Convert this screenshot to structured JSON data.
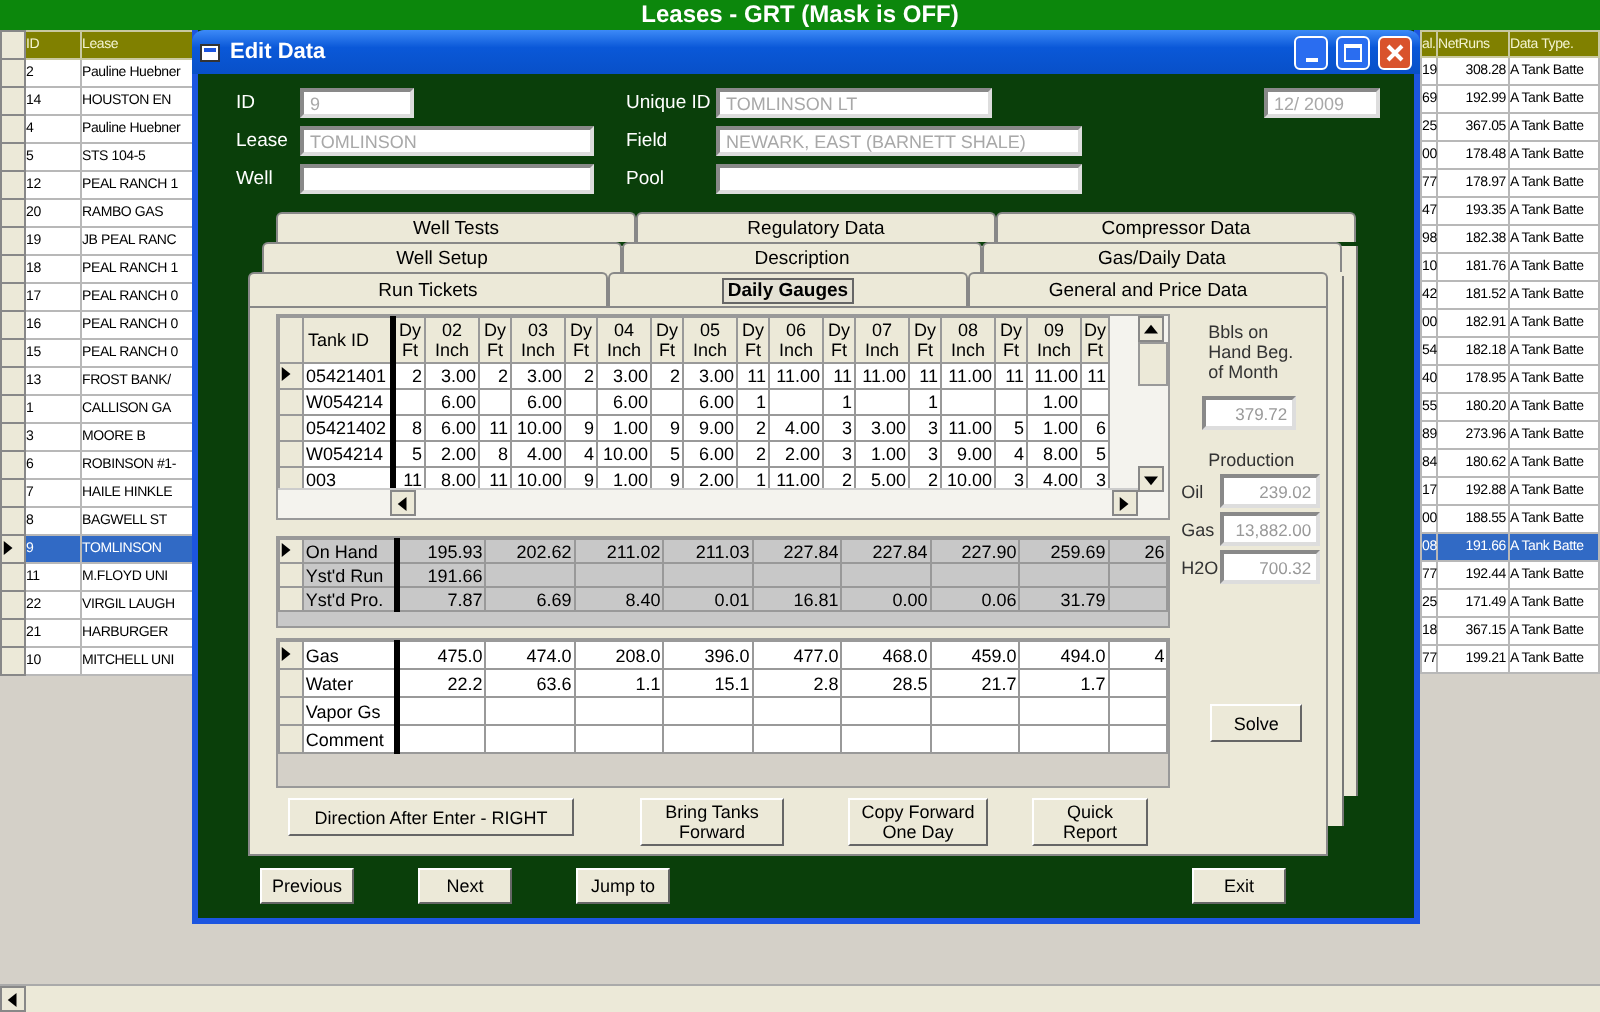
{
  "app_title": "Leases - GRT (Mask is OFF)",
  "leases": {
    "left_columns": [
      "ID",
      "Lease"
    ],
    "right_columns": [
      "al.",
      "NetRuns",
      "Data Type."
    ],
    "rows": [
      {
        "id": "2",
        "lease": "Pauline Huebner",
        "col_3": "19",
        "net_runs": "308.28",
        "data_type": "A Tank Batte",
        "selected": false
      },
      {
        "id": "14",
        "lease": "HOUSTON EN",
        "col_3": "69",
        "net_runs": "192.99",
        "data_type": "A Tank Batte",
        "selected": false
      },
      {
        "id": "4",
        "lease": "Pauline Huebner",
        "col_3": "25",
        "net_runs": "367.05",
        "data_type": "A Tank Batte",
        "selected": false
      },
      {
        "id": "5",
        "lease": "STS 104-5",
        "col_3": "00",
        "net_runs": "178.48",
        "data_type": "A Tank Batte",
        "selected": false
      },
      {
        "id": "12",
        "lease": "PEAL RANCH 1",
        "col_3": "77",
        "net_runs": "178.97",
        "data_type": "A Tank Batte",
        "selected": false
      },
      {
        "id": "20",
        "lease": "RAMBO GAS",
        "col_3": "47",
        "net_runs": "193.35",
        "data_type": "A Tank Batte",
        "selected": false
      },
      {
        "id": "19",
        "lease": "JB PEAL RANC",
        "col_3": "98",
        "net_runs": "182.38",
        "data_type": "A Tank Batte",
        "selected": false
      },
      {
        "id": "18",
        "lease": "PEAL RANCH 1",
        "col_3": "10",
        "net_runs": "181.76",
        "data_type": "A Tank Batte",
        "selected": false
      },
      {
        "id": "17",
        "lease": "PEAL RANCH 0",
        "col_3": "42",
        "net_runs": "181.52",
        "data_type": "A Tank Batte",
        "selected": false
      },
      {
        "id": "16",
        "lease": "PEAL RANCH 0",
        "col_3": "00",
        "net_runs": "182.91",
        "data_type": "A Tank Batte",
        "selected": false
      },
      {
        "id": "15",
        "lease": "PEAL RANCH 0",
        "col_3": "54",
        "net_runs": "182.18",
        "data_type": "A Tank Batte",
        "selected": false
      },
      {
        "id": "13",
        "lease": "FROST BANK/",
        "col_3": "40",
        "net_runs": "178.95",
        "data_type": "A Tank Batte",
        "selected": false
      },
      {
        "id": "1",
        "lease": "CALLISON GA",
        "col_3": "55",
        "net_runs": "180.20",
        "data_type": "A Tank Batte",
        "selected": false
      },
      {
        "id": "3",
        "lease": "MOORE B",
        "col_3": "89",
        "net_runs": "273.96",
        "data_type": "A Tank Batte",
        "selected": false
      },
      {
        "id": "6",
        "lease": "ROBINSON #1-",
        "col_3": "84",
        "net_runs": "180.62",
        "data_type": "A Tank Batte",
        "selected": false
      },
      {
        "id": "7",
        "lease": "HAILE HINKLE",
        "col_3": "17",
        "net_runs": "192.88",
        "data_type": "A Tank Batte",
        "selected": false
      },
      {
        "id": "8",
        "lease": "BAGWELL ST",
        "col_3": "00",
        "net_runs": "188.55",
        "data_type": "A Tank Batte",
        "selected": false
      },
      {
        "id": "9",
        "lease": "TOMLINSON",
        "col_3": "08",
        "net_runs": "191.66",
        "data_type": "A Tank Batte",
        "selected": true
      },
      {
        "id": "11",
        "lease": "M.FLOYD UNI",
        "col_3": "77",
        "net_runs": "192.44",
        "data_type": "A Tank Batte",
        "selected": false
      },
      {
        "id": "22",
        "lease": "VIRGIL LAUGH",
        "col_3": "25",
        "net_runs": "171.49",
        "data_type": "A Tank Batte",
        "selected": false
      },
      {
        "id": "21",
        "lease": "HARBURGER",
        "col_3": "18",
        "net_runs": "367.15",
        "data_type": "A Tank Batte",
        "selected": false
      },
      {
        "id": "10",
        "lease": "MITCHELL UNI",
        "col_3": "77",
        "net_runs": "199.21",
        "data_type": "A Tank Batte",
        "selected": false
      }
    ]
  },
  "dialog": {
    "title": "Edit Data",
    "fields": {
      "id": {
        "label": "ID",
        "value": "9"
      },
      "unique_id": {
        "label": "Unique ID",
        "value": "TOMLINSON LT"
      },
      "date": {
        "value": "12/ 2009"
      },
      "lease": {
        "label": "Lease",
        "value": "TOMLINSON"
      },
      "field": {
        "label": "Field",
        "value": "NEWARK, EAST (BARNETT SHALE)"
      },
      "well": {
        "label": "Well"
      },
      "pool": {
        "label": "Pool"
      }
    },
    "tab_rows": [
      {
        "tabs": [
          {
            "label": "Well Tests",
            "selected": false
          },
          {
            "label": "Regulatory Data",
            "selected": false
          },
          {
            "label": "Compressor Data",
            "selected": false
          }
        ]
      },
      {
        "tabs": [
          {
            "label": "Well Setup",
            "selected": false
          },
          {
            "label": "Description",
            "selected": false
          },
          {
            "label": "Gas/Daily Data",
            "selected": false
          }
        ]
      },
      {
        "tabs": [
          {
            "label": "Run Tickets",
            "selected": false
          },
          {
            "label": "Daily Gauges",
            "selected": true
          },
          {
            "label": "General and Price Data",
            "selected": false
          }
        ]
      }
    ],
    "gauges": {
      "columns": [
        "Tank ID",
        "Dy Ft",
        "02 Inch",
        "Dy Ft",
        "03 Inch",
        "Dy Ft",
        "04 Inch",
        "Dy Ft",
        "05 Inch",
        "Dy Ft",
        "06 Inch",
        "Dy Ft",
        "07 Inch",
        "Dy Ft",
        "08 Inch",
        "Dy Ft",
        "09 Inch",
        "Dy Ft"
      ],
      "rows": [
        {
          "current": true,
          "cells": [
            "05421401",
            "2",
            "3.00",
            "2",
            "3.00",
            "2",
            "3.00",
            "2",
            "3.00",
            "11",
            "11.00",
            "11",
            "11.00",
            "11",
            "11.00",
            "11",
            "11.00",
            "11"
          ]
        },
        {
          "current": false,
          "cells": [
            "W054214",
            "",
            "6.00",
            "",
            "6.00",
            "",
            "6.00",
            "",
            "6.00",
            "1",
            "",
            "1",
            "",
            "1",
            "",
            "",
            "1.00",
            ""
          ]
        },
        {
          "current": false,
          "cells": [
            "05421402",
            "8",
            "6.00",
            "11",
            "10.00",
            "9",
            "1.00",
            "9",
            "9.00",
            "2",
            "4.00",
            "3",
            "3.00",
            "3",
            "11.00",
            "5",
            "1.00",
            "6"
          ]
        },
        {
          "current": false,
          "cells": [
            "W054214",
            "5",
            "2.00",
            "8",
            "4.00",
            "4",
            "10.00",
            "5",
            "6.00",
            "2",
            "2.00",
            "3",
            "1.00",
            "3",
            "9.00",
            "4",
            "8.00",
            "5"
          ]
        },
        {
          "current": false,
          "cells": [
            "003",
            "11",
            "8.00",
            "11",
            "10.00",
            "9",
            "1.00",
            "9",
            "2.00",
            "1",
            "11.00",
            "2",
            "5.00",
            "2",
            "10.00",
            "3",
            "4.00",
            "3"
          ]
        }
      ]
    },
    "totals": {
      "rows": [
        {
          "current": true,
          "cells": [
            "On Hand",
            "195.93",
            "202.62",
            "211.02",
            "211.03",
            "227.84",
            "227.84",
            "227.90",
            "259.69",
            "26"
          ]
        },
        {
          "current": false,
          "cells": [
            "Yst'd Run",
            "191.66",
            "",
            "",
            "",
            "",
            "",
            "",
            "",
            ""
          ]
        },
        {
          "current": false,
          "cells": [
            "Yst'd Pro.",
            "7.87",
            "6.69",
            "8.40",
            "0.01",
            "16.81",
            "0.00",
            "0.06",
            "31.79",
            ""
          ]
        }
      ]
    },
    "daily": {
      "rows": [
        {
          "current": true,
          "cells": [
            "Gas",
            "475.0",
            "474.0",
            "208.0",
            "396.0",
            "477.0",
            "468.0",
            "459.0",
            "494.0",
            "4"
          ]
        },
        {
          "current": false,
          "cells": [
            "Water",
            "22.2",
            "63.6",
            "1.1",
            "15.1",
            "2.8",
            "28.5",
            "21.7",
            "1.7",
            ""
          ]
        },
        {
          "current": false,
          "cells": [
            "Vapor Gs",
            "",
            "",
            "",
            "",
            "",
            "",
            "",
            "",
            ""
          ]
        },
        {
          "current": false,
          "cells": [
            "Comment",
            "",
            "",
            "",
            "",
            "",
            "",
            "",
            "",
            ""
          ]
        }
      ]
    },
    "panel_buttons": [
      "Direction After Enter - RIGHT",
      "Bring Tanks Forward",
      "Copy Forward One Day",
      "Quick Report"
    ],
    "bbls": {
      "label": "Bbls on Hand Beg. of Month",
      "value": "379.72"
    },
    "production": {
      "title": "Production",
      "items": [
        {
          "label": "Oil",
          "value": "239.02"
        },
        {
          "label": "Gas",
          "value": "13,882.00"
        },
        {
          "label": "H2O",
          "value": "700.32"
        }
      ]
    },
    "solve_button": "Solve",
    "nav_buttons": [
      "Previous",
      "Next",
      "Jump to"
    ],
    "exit_button": "Exit"
  }
}
